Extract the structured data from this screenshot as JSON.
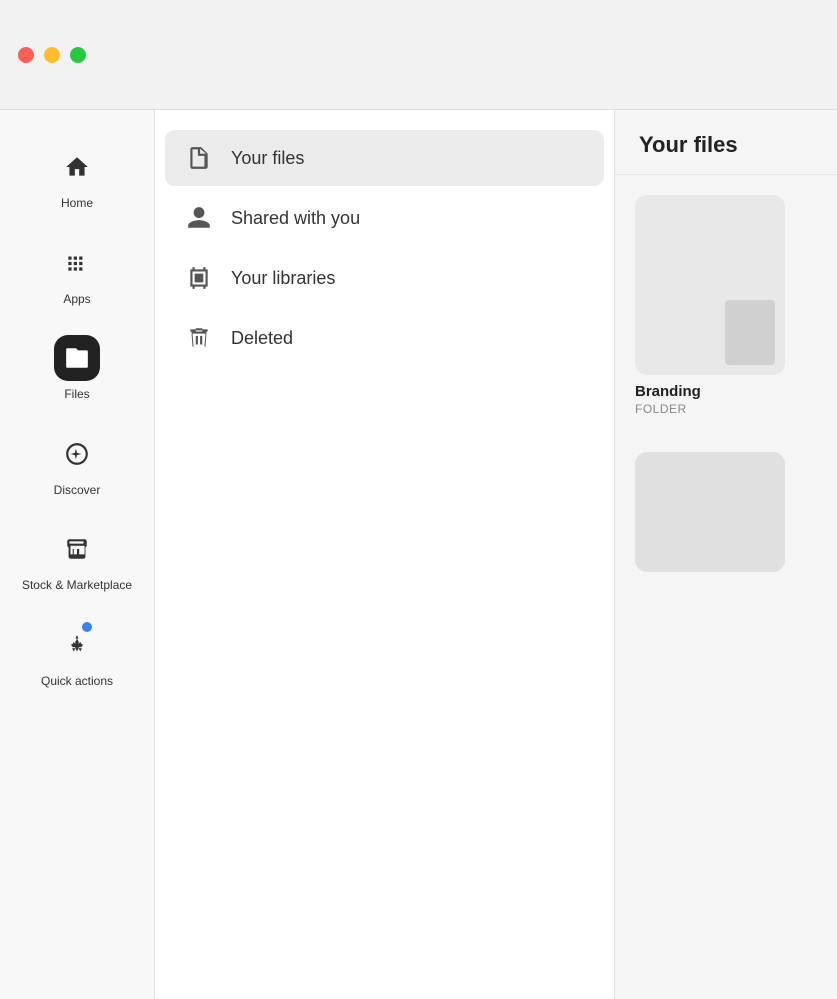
{
  "titlebar": {
    "traffic_lights": [
      "red",
      "yellow",
      "green"
    ]
  },
  "sidebar": {
    "items": [
      {
        "id": "home",
        "label": "Home",
        "icon": "home-icon",
        "active": false
      },
      {
        "id": "apps",
        "label": "Apps",
        "icon": "apps-icon",
        "active": false
      },
      {
        "id": "files",
        "label": "Files",
        "icon": "files-icon",
        "active": true
      },
      {
        "id": "discover",
        "label": "Discover",
        "icon": "discover-icon",
        "active": false
      },
      {
        "id": "stock",
        "label": "Stock & Marketplace",
        "icon": "stock-icon",
        "active": false
      },
      {
        "id": "quick-actions",
        "label": "Quick actions",
        "icon": "quick-actions-icon",
        "active": false,
        "badge": true
      }
    ]
  },
  "secondary_nav": {
    "items": [
      {
        "id": "your-files",
        "label": "Your files",
        "icon": "file-icon",
        "selected": true
      },
      {
        "id": "shared-with-you",
        "label": "Shared with you",
        "icon": "shared-icon",
        "selected": false
      },
      {
        "id": "your-libraries",
        "label": "Your libraries",
        "icon": "libraries-icon",
        "selected": false
      },
      {
        "id": "deleted",
        "label": "Deleted",
        "icon": "deleted-icon",
        "selected": false
      }
    ]
  },
  "main_panel": {
    "title": "Your files",
    "folders": [
      {
        "id": "branding",
        "name": "Branding",
        "type": "FOLDER"
      },
      {
        "id": "folder2",
        "name": "",
        "type": ""
      }
    ]
  }
}
